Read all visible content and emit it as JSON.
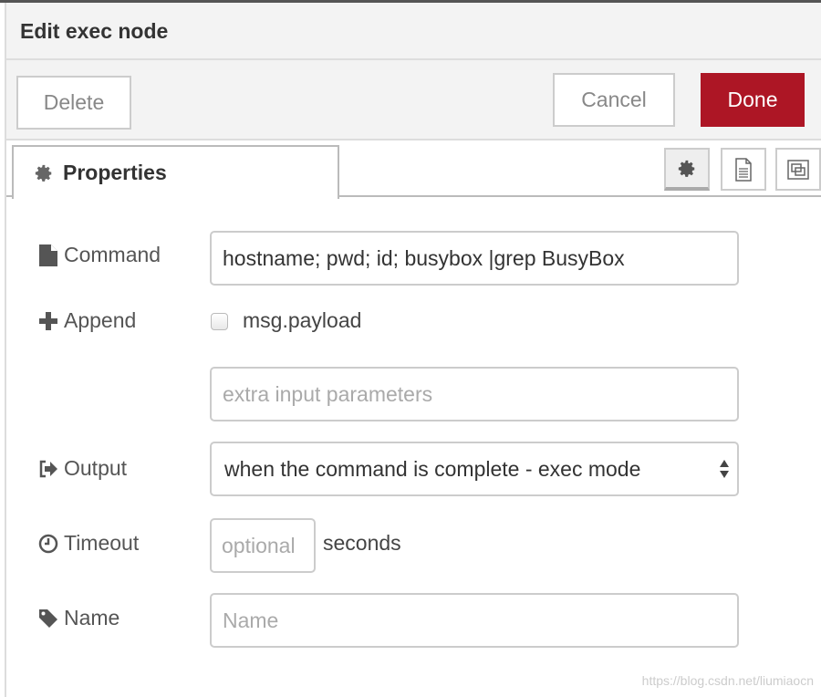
{
  "dialog": {
    "title": "Edit exec node"
  },
  "toolbar": {
    "delete_label": "Delete",
    "cancel_label": "Cancel",
    "done_label": "Done",
    "done_color": "#ad1625"
  },
  "tabs": {
    "properties_label": "Properties",
    "icons": [
      "gear-icon",
      "document-icon",
      "frame-icon"
    ]
  },
  "form": {
    "command": {
      "label": "Command",
      "value": "hostname; pwd; id; busybox |grep BusyBox"
    },
    "append": {
      "label": "Append",
      "checkbox_label": "msg.payload",
      "checked": false
    },
    "extra": {
      "placeholder": "extra input parameters"
    },
    "output": {
      "label": "Output",
      "value": "when the command is complete - exec mode"
    },
    "timeout": {
      "label": "Timeout",
      "placeholder": "optional",
      "unit": "seconds"
    },
    "name": {
      "label": "Name",
      "placeholder": "Name"
    }
  },
  "watermark": "https://blog.csdn.net/liumiaocn"
}
